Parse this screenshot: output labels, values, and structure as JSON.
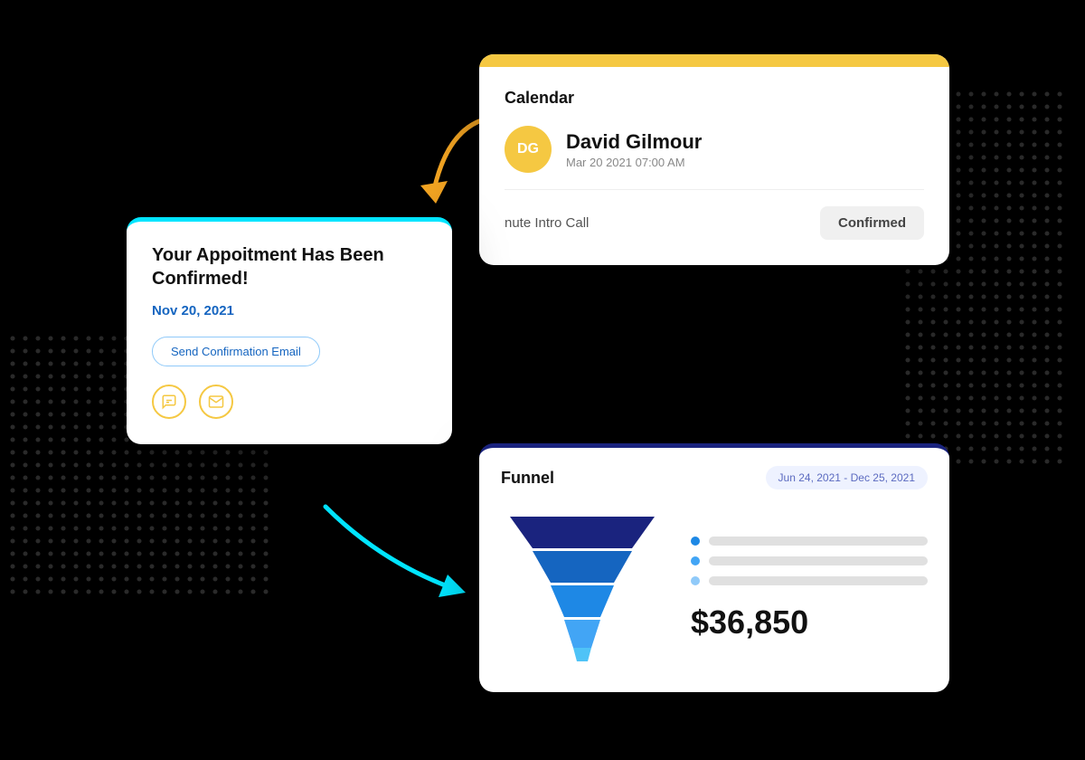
{
  "background": "#000000",
  "calendar_card": {
    "header_color": "#F5C842",
    "title": "Calendar",
    "avatar_initials": "DG",
    "avatar_bg": "#F5C842",
    "contact_name": "David Gilmour",
    "contact_date": "Mar 20 2021 07:00 AM",
    "meeting_label": "nute Intro Call",
    "confirmed_label": "Confirmed"
  },
  "appointment_card": {
    "border_color": "#00E5FF",
    "title": "Your Appoitment Has Been Confirmed!",
    "date": "Nov 20, 2021",
    "button_label": "Send Confirmation Email",
    "icon_chat": "⊟",
    "icon_mail": "✉"
  },
  "funnel_card": {
    "border_color": "#1A237E",
    "title": "Funnel",
    "date_range": "Jun 24, 2021 - Dec 25, 2021",
    "amount": "$36,850",
    "legend": [
      {
        "color": "#1E88E5"
      },
      {
        "color": "#42A5F5"
      },
      {
        "color": "#90CAF9"
      }
    ]
  },
  "arrows": {
    "orange": "↙",
    "cyan": "→"
  }
}
